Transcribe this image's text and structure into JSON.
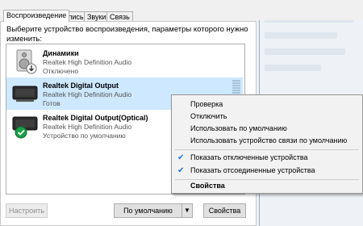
{
  "tabs": [
    "Воспроизведение",
    "Запись",
    "Звуки",
    "Связь"
  ],
  "instruction": "Выберите устройство воспроизведения, параметры которого нужно изменить:",
  "devices": [
    {
      "name": "Динамики",
      "description": "Realtek High Definition Audio",
      "status": "Отключено",
      "icon": "speaker-icon"
    },
    {
      "name": "Realtek Digital Output",
      "description": "Realtek High Definition Audio",
      "status": "Готов",
      "icon": "digital-output-icon"
    },
    {
      "name": "Realtek Digital Output(Optical)",
      "description": "Realtek High Definition Audio",
      "status": "Устройство по умолчанию",
      "icon": "optical-output-icon"
    }
  ],
  "context_menu": {
    "items": [
      {
        "label": "Проверка",
        "checked": false
      },
      {
        "label": "Отключить",
        "checked": false
      },
      {
        "label": "Использовать по умолчанию",
        "checked": false
      },
      {
        "label": "Использовать устройство связи по умолчанию",
        "checked": false
      },
      {
        "label": "Показать отключенные устройства",
        "checked": true
      },
      {
        "label": "Показать отсоединенные устройства",
        "checked": true
      },
      {
        "label": "Свойства",
        "checked": false,
        "bold": true
      }
    ]
  },
  "buttons": {
    "configure": "Настроить",
    "default": "По умолчанию",
    "properties": "Свойства"
  },
  "colors": {
    "selection": "#cde8ff",
    "default_badge": "#1aa14a",
    "check": "#1a6fd8"
  }
}
